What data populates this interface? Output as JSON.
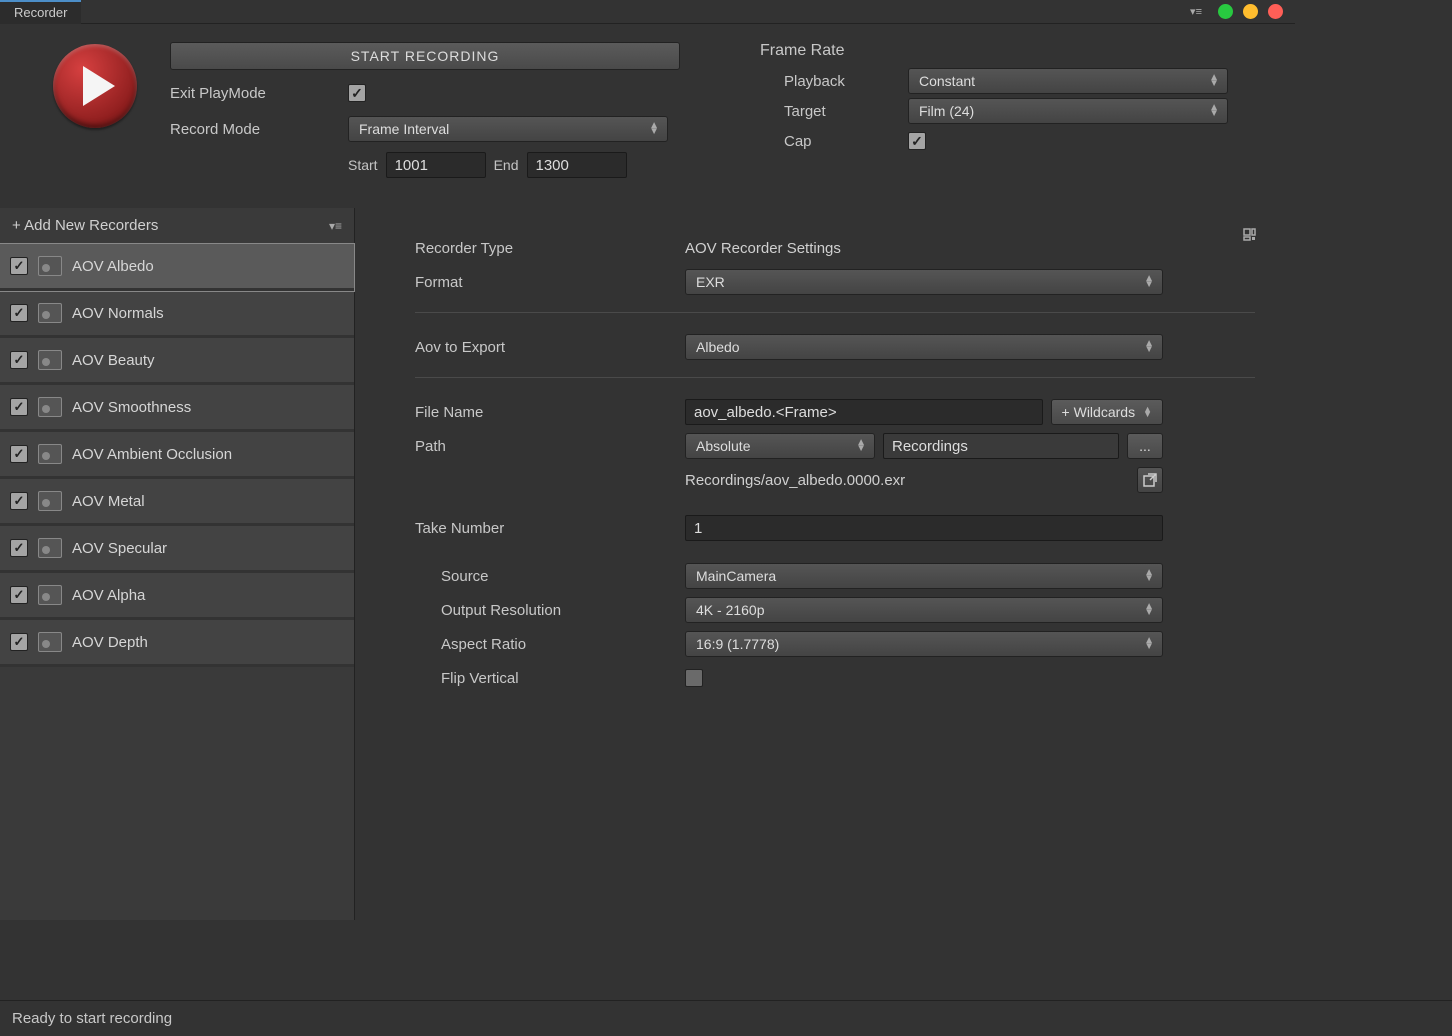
{
  "titlebar": {
    "tab": "Recorder"
  },
  "top": {
    "start_label": "START RECORDING",
    "exit_playmode_label": "Exit PlayMode",
    "record_mode_label": "Record Mode",
    "record_mode_value": "Frame Interval",
    "start_label_txt": "Start",
    "start_value": "1001",
    "end_label_txt": "End",
    "end_value": "1300"
  },
  "framerate": {
    "title": "Frame Rate",
    "playback_label": "Playback",
    "playback_value": "Constant",
    "target_label": "Target",
    "target_value": "Film (24)",
    "cap_label": "Cap"
  },
  "sidebar": {
    "add_label": "+ Add New Recorders",
    "items": [
      {
        "name": "AOV Albedo",
        "selected": true
      },
      {
        "name": "AOV Normals",
        "selected": false
      },
      {
        "name": "AOV Beauty",
        "selected": false
      },
      {
        "name": "AOV Smoothness",
        "selected": false
      },
      {
        "name": "AOV Ambient Occlusion",
        "selected": false
      },
      {
        "name": "AOV Metal",
        "selected": false
      },
      {
        "name": "AOV Specular",
        "selected": false
      },
      {
        "name": "AOV Alpha",
        "selected": false
      },
      {
        "name": "AOV Depth",
        "selected": false
      }
    ]
  },
  "details": {
    "recorder_type_label": "Recorder Type",
    "recorder_type_value": "AOV Recorder Settings",
    "format_label": "Format",
    "format_value": "EXR",
    "aov_export_label": "Aov to Export",
    "aov_export_value": "Albedo",
    "file_name_label": "File Name",
    "file_name_value": "aov_albedo.<Frame>",
    "wildcards_label": "+ Wildcards",
    "path_label": "Path",
    "path_mode": "Absolute",
    "path_value": "Recordings",
    "browse_label": "...",
    "resolved_path": "Recordings/aov_albedo.0000.exr",
    "take_label": "Take Number",
    "take_value": "1",
    "source_label": "Source",
    "source_value": "MainCamera",
    "output_res_label": "Output Resolution",
    "output_res_value": "4K - 2160p",
    "aspect_label": "Aspect Ratio",
    "aspect_value": "16:9 (1.7778)",
    "flip_label": "Flip Vertical"
  },
  "status": "Ready to start recording"
}
